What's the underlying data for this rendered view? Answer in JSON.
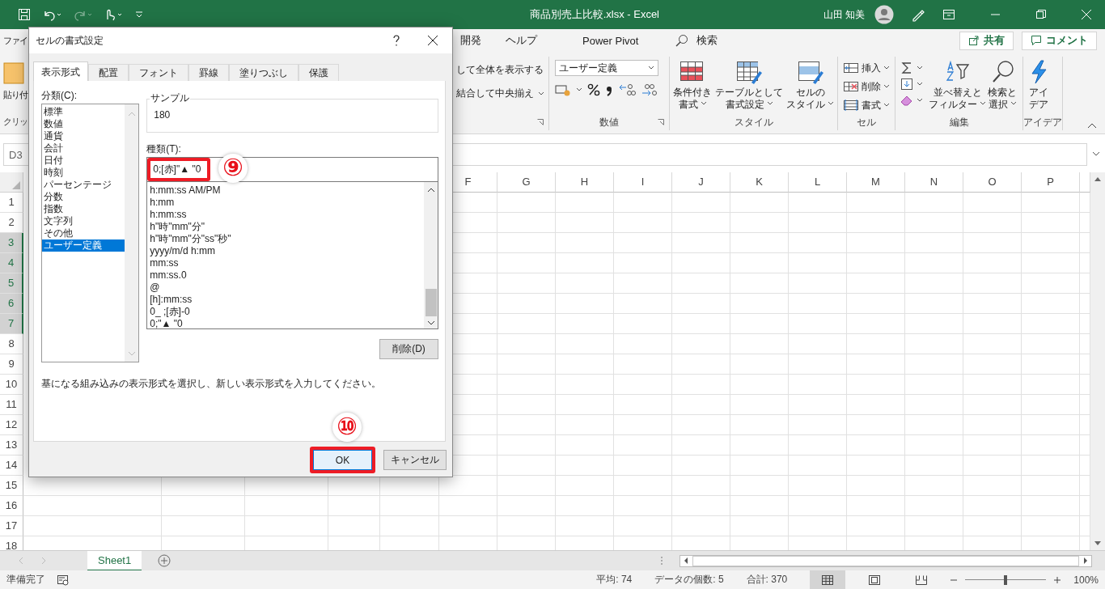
{
  "title_bar": {
    "title": "商品別売上比較.xlsx  -  Excel",
    "user": "山田 知美"
  },
  "ribbon_tabs": [
    {
      "label": "ファイ"
    },
    {
      "label": "開発"
    },
    {
      "label": "ヘルプ"
    },
    {
      "label": "Power Pivot"
    }
  ],
  "search": {
    "label": "検索"
  },
  "share_button": "共有",
  "comment_button": "コメント",
  "ribbon": {
    "paste_label": "貼り付",
    "clipboard_label": "クリッ",
    "alignment": [
      "して全体を表示する",
      "結合して中央揃え"
    ],
    "number": {
      "format": "ユーザー定義",
      "label": "数値"
    },
    "styles": {
      "buttons": [
        {
          "lines": [
            "条件付き",
            "書式"
          ],
          "kind": "conditional"
        },
        {
          "lines": [
            "テーブルとして",
            "書式設定"
          ],
          "kind": "table"
        },
        {
          "lines": [
            "セルの",
            "スタイル"
          ],
          "kind": "cellstyle"
        }
      ],
      "label": "スタイル"
    },
    "cells": {
      "items": [
        {
          "label": "挿入",
          "kind": "insert"
        },
        {
          "label": "削除",
          "kind": "delete"
        },
        {
          "label": "書式",
          "kind": "format"
        }
      ],
      "label": "セル"
    },
    "editing": {
      "buttons": [
        {
          "lines": [
            "並べ替えと",
            "フィルター"
          ],
          "kind": "sort"
        },
        {
          "lines": [
            "検索と",
            "選択"
          ],
          "kind": "find"
        }
      ],
      "label": "編集"
    },
    "ideas": {
      "lines": [
        "アイ",
        "デア"
      ],
      "label": "アイデア"
    }
  },
  "formula_bar": {
    "name_box": "D3"
  },
  "sheet": {
    "columns": [
      "F",
      "G",
      "H",
      "I",
      "J",
      "K",
      "L",
      "M",
      "N",
      "O",
      "P"
    ],
    "rows": [
      {
        "label": "1",
        "selected": false
      },
      {
        "label": "2",
        "selected": false
      },
      {
        "label": "3",
        "selected": true
      },
      {
        "label": "4",
        "selected": true
      },
      {
        "label": "5",
        "selected": true
      },
      {
        "label": "6",
        "selected": true
      },
      {
        "label": "7",
        "selected": true
      },
      {
        "label": "8",
        "selected": false
      },
      {
        "label": "9",
        "selected": false
      },
      {
        "label": "10",
        "selected": false
      },
      {
        "label": "11",
        "selected": false
      },
      {
        "label": "12",
        "selected": false
      },
      {
        "label": "13",
        "selected": false
      },
      {
        "label": "14",
        "selected": false
      },
      {
        "label": "15",
        "selected": false
      },
      {
        "label": "16",
        "selected": false
      },
      {
        "label": "17",
        "selected": false
      },
      {
        "label": "18",
        "selected": false
      }
    ]
  },
  "sheet_tabs": [
    {
      "label": "Sheet1",
      "selected": true
    }
  ],
  "status_bar": {
    "mode": "準備完了",
    "stats": [
      "平均: 74",
      "データの個数: 5",
      "合計: 370"
    ],
    "views": [
      {
        "kind": "normal",
        "selected": true
      },
      {
        "kind": "page_layout",
        "selected": false
      },
      {
        "kind": "page_break",
        "selected": false
      }
    ],
    "zoom": {
      "level": 0.5,
      "reading": "100%"
    }
  },
  "dialog": {
    "title": "セルの書式設定",
    "tabs": [
      {
        "label": "表示形式",
        "selected": true
      },
      {
        "label": "配置",
        "selected": false
      },
      {
        "label": "フォント",
        "selected": false
      },
      {
        "label": "罫線",
        "selected": false
      },
      {
        "label": "塗りつぶし",
        "selected": false
      },
      {
        "label": "保護",
        "selected": false
      }
    ],
    "category_label": "分類(C):",
    "categories": [
      {
        "label": "標準",
        "selected": false
      },
      {
        "label": "数値",
        "selected": false
      },
      {
        "label": "通貨",
        "selected": false
      },
      {
        "label": "会計",
        "selected": false
      },
      {
        "label": "日付",
        "selected": false
      },
      {
        "label": "時刻",
        "selected": false
      },
      {
        "label": "パーセンテージ",
        "selected": false
      },
      {
        "label": "分数",
        "selected": false
      },
      {
        "label": "指数",
        "selected": false
      },
      {
        "label": "文字列",
        "selected": false
      },
      {
        "label": "その他",
        "selected": false
      },
      {
        "label": "ユーザー定義",
        "selected": true
      }
    ],
    "sample_label": "サンプル",
    "sample_value": "180",
    "type_label": "種類(T):",
    "type_value": "0;[赤]\"▲ \"0",
    "formats": [
      "h:mm:ss AM/PM",
      "h:mm",
      "h:mm:ss",
      "h\"時\"mm\"分\"",
      "h\"時\"mm\"分\"ss\"秒\"",
      "yyyy/m/d h:mm",
      "mm:ss",
      "mm:ss.0",
      "@",
      "[h]:mm:ss",
      "0_ ;[赤]-0",
      "0;\"▲ \"0"
    ],
    "delete_button": "削除(D)",
    "description": "基になる組み込みの表示形式を選択し、新しい表示形式を入力してください。",
    "ok_button": "OK",
    "cancel_button": "キャンセル",
    "type_step": "⑨",
    "ok_step": "⑩"
  }
}
